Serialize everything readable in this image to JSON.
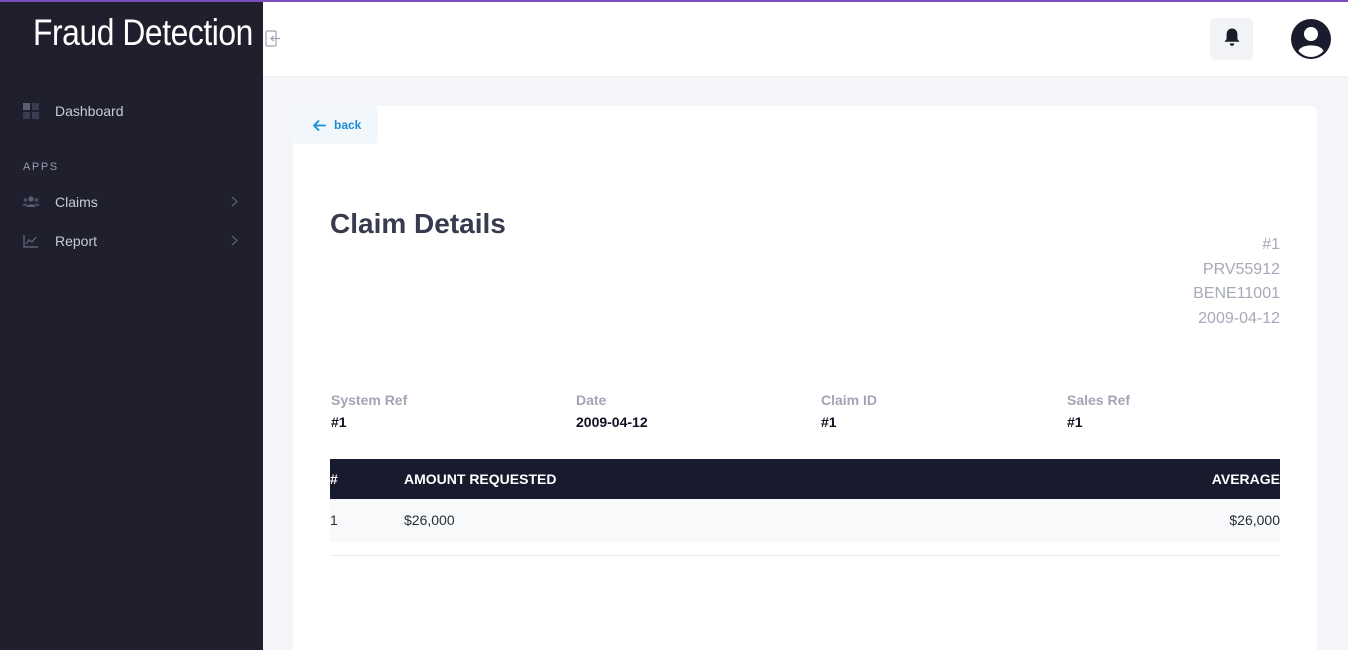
{
  "app": {
    "brand": "Fraud Detection"
  },
  "sidebar": {
    "items": [
      {
        "label": "Dashboard",
        "icon": "dashboard-icon"
      },
      {
        "label": "Claims",
        "icon": "users-icon"
      },
      {
        "label": "Report",
        "icon": "chart-line-icon"
      }
    ],
    "section_label": "APPS"
  },
  "header": {
    "bell_icon": "bell-icon",
    "avatar_icon": "user-circle-icon"
  },
  "content": {
    "back_label": "back",
    "title": "Claim Details",
    "meta": [
      "#1",
      "PRV55912",
      "BENE11001",
      "2009-04-12"
    ],
    "info": [
      {
        "label": "System Ref",
        "value": "#1"
      },
      {
        "label": "Date",
        "value": "2009-04-12"
      },
      {
        "label": "Claim ID",
        "value": "#1"
      },
      {
        "label": "Sales Ref",
        "value": "#1"
      }
    ],
    "table": {
      "headers": [
        "#",
        "AMOUNT REQUESTED",
        "AVERAGE"
      ],
      "rows": [
        [
          "1",
          "$26,000",
          "$26,000"
        ]
      ]
    }
  },
  "colors": {
    "sidebar_bg": "#1f1f2e",
    "accent_bar": "#7c4dbd",
    "link_blue": "#1d8bd6",
    "table_header_bg": "#181a2e"
  }
}
